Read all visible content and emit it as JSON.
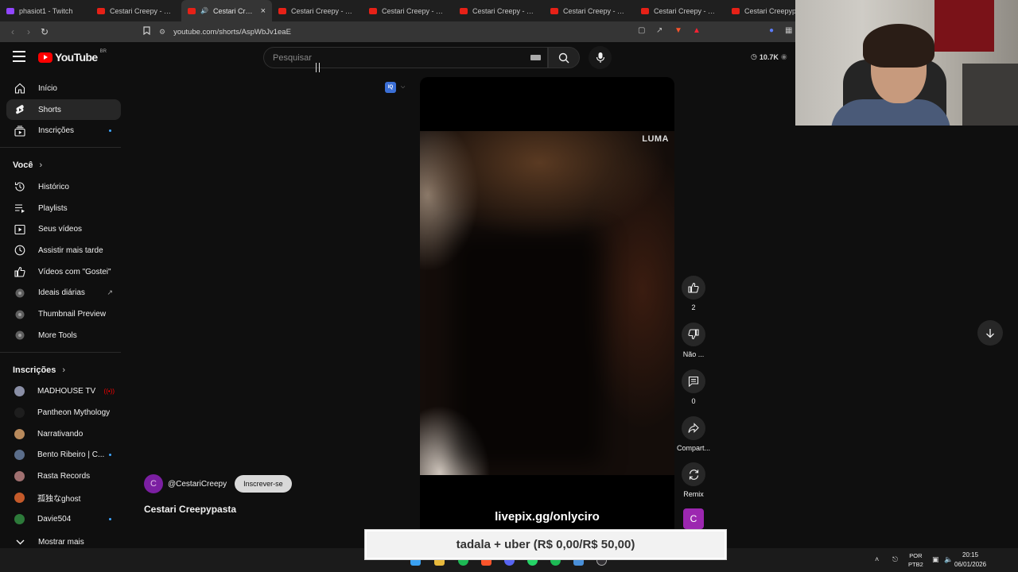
{
  "tabs": [
    {
      "label": "phasiot1 - Twitch",
      "favicon": "twitch-icon",
      "active": false
    },
    {
      "label": "Cestari Creepy - YouTu",
      "favicon": "youtube-icon",
      "active": false
    },
    {
      "label": "Cestari Creepy",
      "favicon": "youtube-icon",
      "active": true,
      "close": "×"
    },
    {
      "label": "Cestari Creepy - YouTu",
      "favicon": "youtube-icon",
      "active": false
    },
    {
      "label": "Cestari Creepy - YouTu",
      "favicon": "youtube-icon",
      "active": false
    },
    {
      "label": "Cestari Creepy - YouTu",
      "favicon": "youtube-icon",
      "active": false
    },
    {
      "label": "Cestari Creepy - YouTu",
      "favicon": "youtube-icon",
      "active": false
    },
    {
      "label": "Cestari Creepy - YouTu",
      "favicon": "youtube-icon",
      "active": false
    },
    {
      "label": "Cestari Creepypas",
      "favicon": "youtube-icon",
      "active": false
    }
  ],
  "address_bar": {
    "url": "youtube.com/shorts/AspWbJv1eaE"
  },
  "header": {
    "logo_text": "YouTube",
    "country_code": "BR",
    "search_placeholder": "Pesquisar",
    "viewer_count": "10.7K"
  },
  "sidebar": {
    "main": [
      {
        "label": "Início",
        "icon": "home-icon"
      },
      {
        "label": "Shorts",
        "icon": "shorts-icon",
        "active": true
      },
      {
        "label": "Inscrições",
        "icon": "subscriptions-icon",
        "dot": true
      }
    ],
    "you_heading": "Você",
    "you_items": [
      {
        "label": "Histórico",
        "icon": "history-icon"
      },
      {
        "label": "Playlists",
        "icon": "playlists-icon"
      },
      {
        "label": "Seus vídeos",
        "icon": "your-videos-icon"
      },
      {
        "label": "Assistir mais tarde",
        "icon": "watch-later-icon"
      },
      {
        "label": "Vídeos com \"Gostei\"",
        "icon": "liked-icon"
      },
      {
        "label": "Ideais diárias",
        "icon": "extension-icon",
        "external": true
      },
      {
        "label": "Thumbnail Preview",
        "icon": "extension-icon"
      },
      {
        "label": "More Tools",
        "icon": "extension-icon"
      }
    ],
    "subs_heading": "Inscrições",
    "subscriptions": [
      {
        "label": "MADHOUSE TV",
        "color": "#8a8fa6",
        "live": true
      },
      {
        "label": "Pantheon Mythology",
        "color": "#1e1e1e"
      },
      {
        "label": "Narrativando",
        "color": "#b88a5c"
      },
      {
        "label": "Bento Ribeiro | C...",
        "color": "#5a6d8a",
        "dot": true
      },
      {
        "label": "Rasta Records",
        "color": "#a07070"
      },
      {
        "label": "孤独なghost",
        "color": "#c45a2a"
      },
      {
        "label": "Davie504",
        "color": "#2d7a3a",
        "dot": true
      }
    ],
    "show_more": "Mostrar mais"
  },
  "video": {
    "watermark": "LUMA",
    "overlay_text": "livepix.gg/onlyciro",
    "iq_badge": "IQ"
  },
  "actions": {
    "likes": "2",
    "dislike_label": "Não ...",
    "comments": "0",
    "share_label": "Compart...",
    "remix_label": "Remix",
    "channel_initial": "C"
  },
  "channel": {
    "initial": "C",
    "handle": "@CestariCreepy",
    "subscribe_label": "Inscrever-se",
    "video_title": "Cestari Creepypasta"
  },
  "donation_bar": {
    "text": "tadala + uber (R$ 0,00/R$ 50,00)"
  },
  "taskbar": {
    "lang_1": "POR",
    "lang_2": "PTB2",
    "time": "20:15",
    "date": "06/01/2026"
  },
  "colors": {
    "youtube_red": "#ff0000",
    "accent_blue": "#3ea6ff",
    "channel_purple": "#9c27b0"
  }
}
